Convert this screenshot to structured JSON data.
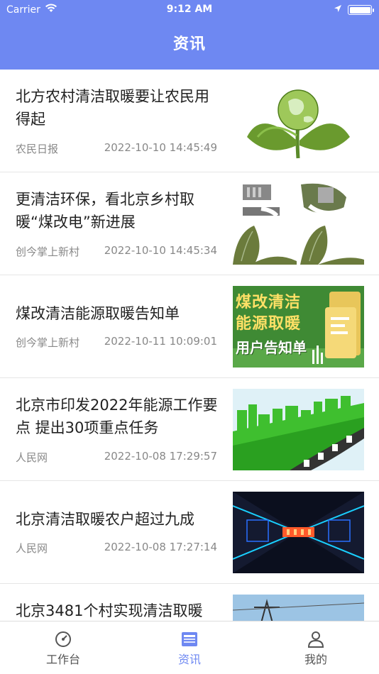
{
  "status_bar": {
    "carrier": "Carrier",
    "time": "9:12 AM"
  },
  "header": {
    "title": "资讯"
  },
  "news": [
    {
      "title": "北方农村清洁取暖要让农民用得起",
      "source": "农民日报",
      "time": "2022-10-10 14:45:49"
    },
    {
      "title": "更清洁环保，看北京乡村取暖“煤改电”新进展",
      "source": "创今掌上新村",
      "time": "2022-10-10 14:45:34"
    },
    {
      "title": "煤改清洁能源取暖告知单",
      "source": "创今掌上新村",
      "time": "2022-10-11 10:09:01",
      "thumb_text": [
        "煤改清洁",
        "能源取暖",
        "用户告知单"
      ]
    },
    {
      "title": "北京市印发2022年能源工作要点 提出30项重点任务",
      "source": "人民网",
      "time": "2022-10-08 17:29:57"
    },
    {
      "title": "北京清洁取暖农户超过九成",
      "source": "人民网",
      "time": "2022-10-08 17:27:14"
    },
    {
      "title": "北京3481个村实现清洁取暖",
      "source": "",
      "time": ""
    }
  ],
  "tabbar": [
    {
      "label": "工作台",
      "icon": "dashboard-icon",
      "active": false
    },
    {
      "label": "资讯",
      "icon": "news-icon",
      "active": true
    },
    {
      "label": "我的",
      "icon": "user-icon",
      "active": false
    }
  ],
  "colors": {
    "accent": "#6E88F2"
  }
}
